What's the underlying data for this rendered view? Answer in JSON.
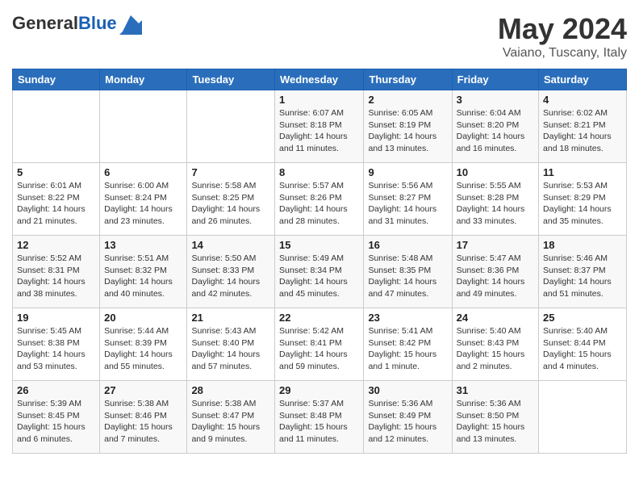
{
  "header": {
    "logo_general": "General",
    "logo_blue": "Blue",
    "title": "May 2024",
    "location": "Vaiano, Tuscany, Italy"
  },
  "calendar": {
    "days_of_week": [
      "Sunday",
      "Monday",
      "Tuesday",
      "Wednesday",
      "Thursday",
      "Friday",
      "Saturday"
    ],
    "weeks": [
      [
        {
          "num": "",
          "info": ""
        },
        {
          "num": "",
          "info": ""
        },
        {
          "num": "",
          "info": ""
        },
        {
          "num": "1",
          "info": "Sunrise: 6:07 AM\nSunset: 8:18 PM\nDaylight: 14 hours\nand 11 minutes."
        },
        {
          "num": "2",
          "info": "Sunrise: 6:05 AM\nSunset: 8:19 PM\nDaylight: 14 hours\nand 13 minutes."
        },
        {
          "num": "3",
          "info": "Sunrise: 6:04 AM\nSunset: 8:20 PM\nDaylight: 14 hours\nand 16 minutes."
        },
        {
          "num": "4",
          "info": "Sunrise: 6:02 AM\nSunset: 8:21 PM\nDaylight: 14 hours\nand 18 minutes."
        }
      ],
      [
        {
          "num": "5",
          "info": "Sunrise: 6:01 AM\nSunset: 8:22 PM\nDaylight: 14 hours\nand 21 minutes."
        },
        {
          "num": "6",
          "info": "Sunrise: 6:00 AM\nSunset: 8:24 PM\nDaylight: 14 hours\nand 23 minutes."
        },
        {
          "num": "7",
          "info": "Sunrise: 5:58 AM\nSunset: 8:25 PM\nDaylight: 14 hours\nand 26 minutes."
        },
        {
          "num": "8",
          "info": "Sunrise: 5:57 AM\nSunset: 8:26 PM\nDaylight: 14 hours\nand 28 minutes."
        },
        {
          "num": "9",
          "info": "Sunrise: 5:56 AM\nSunset: 8:27 PM\nDaylight: 14 hours\nand 31 minutes."
        },
        {
          "num": "10",
          "info": "Sunrise: 5:55 AM\nSunset: 8:28 PM\nDaylight: 14 hours\nand 33 minutes."
        },
        {
          "num": "11",
          "info": "Sunrise: 5:53 AM\nSunset: 8:29 PM\nDaylight: 14 hours\nand 35 minutes."
        }
      ],
      [
        {
          "num": "12",
          "info": "Sunrise: 5:52 AM\nSunset: 8:31 PM\nDaylight: 14 hours\nand 38 minutes."
        },
        {
          "num": "13",
          "info": "Sunrise: 5:51 AM\nSunset: 8:32 PM\nDaylight: 14 hours\nand 40 minutes."
        },
        {
          "num": "14",
          "info": "Sunrise: 5:50 AM\nSunset: 8:33 PM\nDaylight: 14 hours\nand 42 minutes."
        },
        {
          "num": "15",
          "info": "Sunrise: 5:49 AM\nSunset: 8:34 PM\nDaylight: 14 hours\nand 45 minutes."
        },
        {
          "num": "16",
          "info": "Sunrise: 5:48 AM\nSunset: 8:35 PM\nDaylight: 14 hours\nand 47 minutes."
        },
        {
          "num": "17",
          "info": "Sunrise: 5:47 AM\nSunset: 8:36 PM\nDaylight: 14 hours\nand 49 minutes."
        },
        {
          "num": "18",
          "info": "Sunrise: 5:46 AM\nSunset: 8:37 PM\nDaylight: 14 hours\nand 51 minutes."
        }
      ],
      [
        {
          "num": "19",
          "info": "Sunrise: 5:45 AM\nSunset: 8:38 PM\nDaylight: 14 hours\nand 53 minutes."
        },
        {
          "num": "20",
          "info": "Sunrise: 5:44 AM\nSunset: 8:39 PM\nDaylight: 14 hours\nand 55 minutes."
        },
        {
          "num": "21",
          "info": "Sunrise: 5:43 AM\nSunset: 8:40 PM\nDaylight: 14 hours\nand 57 minutes."
        },
        {
          "num": "22",
          "info": "Sunrise: 5:42 AM\nSunset: 8:41 PM\nDaylight: 14 hours\nand 59 minutes."
        },
        {
          "num": "23",
          "info": "Sunrise: 5:41 AM\nSunset: 8:42 PM\nDaylight: 15 hours\nand 1 minute."
        },
        {
          "num": "24",
          "info": "Sunrise: 5:40 AM\nSunset: 8:43 PM\nDaylight: 15 hours\nand 2 minutes."
        },
        {
          "num": "25",
          "info": "Sunrise: 5:40 AM\nSunset: 8:44 PM\nDaylight: 15 hours\nand 4 minutes."
        }
      ],
      [
        {
          "num": "26",
          "info": "Sunrise: 5:39 AM\nSunset: 8:45 PM\nDaylight: 15 hours\nand 6 minutes."
        },
        {
          "num": "27",
          "info": "Sunrise: 5:38 AM\nSunset: 8:46 PM\nDaylight: 15 hours\nand 7 minutes."
        },
        {
          "num": "28",
          "info": "Sunrise: 5:38 AM\nSunset: 8:47 PM\nDaylight: 15 hours\nand 9 minutes."
        },
        {
          "num": "29",
          "info": "Sunrise: 5:37 AM\nSunset: 8:48 PM\nDaylight: 15 hours\nand 11 minutes."
        },
        {
          "num": "30",
          "info": "Sunrise: 5:36 AM\nSunset: 8:49 PM\nDaylight: 15 hours\nand 12 minutes."
        },
        {
          "num": "31",
          "info": "Sunrise: 5:36 AM\nSunset: 8:50 PM\nDaylight: 15 hours\nand 13 minutes."
        },
        {
          "num": "",
          "info": ""
        }
      ]
    ]
  }
}
